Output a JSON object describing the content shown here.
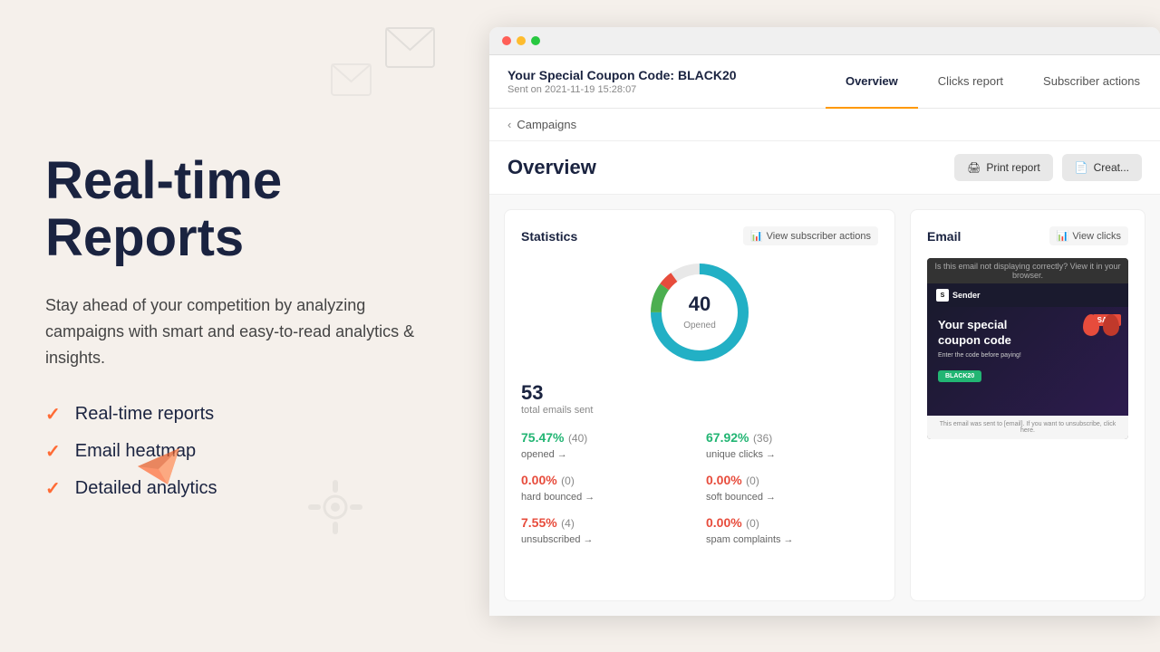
{
  "left": {
    "heading": "Real-time Reports",
    "subtitle": "Stay ahead of your competition by analyzing campaigns with smart and easy-to-read analytics & insights.",
    "features": [
      {
        "label": "Real-time reports"
      },
      {
        "label": "Email heatmap"
      },
      {
        "label": "Detailed analytics"
      }
    ]
  },
  "browser": {
    "campaign": {
      "title": "Your Special Coupon Code: BLACK20",
      "date": "Sent on 2021-11-19 15:28:07"
    },
    "nav": {
      "tabs": [
        {
          "label": "Overview",
          "active": true
        },
        {
          "label": "Clicks report",
          "active": false
        },
        {
          "label": "Subscriber actions",
          "active": false
        }
      ]
    },
    "breadcrumb": "Campaigns",
    "page_title": "Overview",
    "buttons": {
      "print": "Print report",
      "create": "Creat..."
    },
    "stats_card": {
      "title": "Statistics",
      "view_btn": "View subscriber actions",
      "donut": {
        "number": "40",
        "label": "Opened"
      },
      "total": {
        "number": "53",
        "label": "total emails sent"
      },
      "metrics": [
        {
          "value": "75.47%",
          "count": "(40)",
          "label": "opened",
          "color": "green"
        },
        {
          "value": "67.92%",
          "count": "(36)",
          "label": "unique clicks",
          "color": "green"
        },
        {
          "value": "0.00%",
          "count": "(0)",
          "label": "hard bounced",
          "color": "red"
        },
        {
          "value": "0.00%",
          "count": "(0)",
          "label": "soft bounced",
          "color": "red"
        },
        {
          "value": "7.55%",
          "count": "(4)",
          "label": "unsubscribed",
          "color": "red"
        },
        {
          "value": "0.00%",
          "count": "(0)",
          "label": "spam complaints",
          "color": "red"
        }
      ]
    },
    "email_card": {
      "title": "Email",
      "view_btn": "View clicks",
      "preview": {
        "top_bar": "Is this email not displaying correctly? View it in your browser.",
        "logo": "Sender",
        "sale_badge": "SALE",
        "heading": "Your special coupon code",
        "subtext": "Enter the code before paying!",
        "coupon": "BLACK20",
        "footer": "This email was sent to [email]. If you want to unsubscribe, click here."
      }
    }
  }
}
